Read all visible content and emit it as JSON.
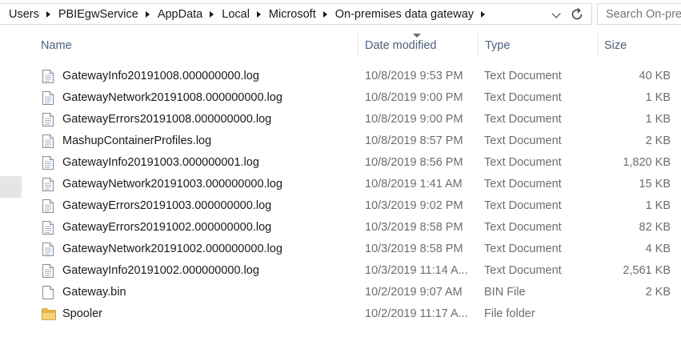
{
  "breadcrumb": [
    "Users",
    "PBIEgwService",
    "AppData",
    "Local",
    "Microsoft",
    "On-premises data gateway"
  ],
  "search": {
    "placeholder": "Search On-premises data gateway"
  },
  "columns": {
    "name": "Name",
    "date": "Date modified",
    "type": "Type",
    "size": "Size"
  },
  "sort": {
    "column": "date",
    "direction": "descending"
  },
  "files": [
    {
      "name": "GatewayInfo20191008.000000000.log",
      "date": "10/8/2019 9:53 PM",
      "type": "Text Document",
      "size": "40 KB",
      "icon": "text-file-icon"
    },
    {
      "name": "GatewayNetwork20191008.000000000.log",
      "date": "10/8/2019 9:00 PM",
      "type": "Text Document",
      "size": "1 KB",
      "icon": "text-file-icon"
    },
    {
      "name": "GatewayErrors20191008.000000000.log",
      "date": "10/8/2019 9:00 PM",
      "type": "Text Document",
      "size": "1 KB",
      "icon": "text-file-icon"
    },
    {
      "name": "MashupContainerProfiles.log",
      "date": "10/8/2019 8:57 PM",
      "type": "Text Document",
      "size": "2 KB",
      "icon": "text-file-icon"
    },
    {
      "name": "GatewayInfo20191003.000000001.log",
      "date": "10/8/2019 8:56 PM",
      "type": "Text Document",
      "size": "1,820 KB",
      "icon": "text-file-icon"
    },
    {
      "name": "GatewayNetwork20191003.000000000.log",
      "date": "10/8/2019 1:41 AM",
      "type": "Text Document",
      "size": "15 KB",
      "icon": "text-file-icon"
    },
    {
      "name": "GatewayErrors20191003.000000000.log",
      "date": "10/3/2019 9:02 PM",
      "type": "Text Document",
      "size": "1 KB",
      "icon": "text-file-icon"
    },
    {
      "name": "GatewayErrors20191002.000000000.log",
      "date": "10/3/2019 8:58 PM",
      "type": "Text Document",
      "size": "82 KB",
      "icon": "text-file-icon"
    },
    {
      "name": "GatewayNetwork20191002.000000000.log",
      "date": "10/3/2019 8:58 PM",
      "type": "Text Document",
      "size": "4 KB",
      "icon": "text-file-icon"
    },
    {
      "name": "GatewayInfo20191002.000000000.log",
      "date": "10/3/2019 11:14 A...",
      "type": "Text Document",
      "size": "2,561 KB",
      "icon": "text-file-icon"
    },
    {
      "name": "Gateway.bin",
      "date": "10/2/2019 9:07 AM",
      "type": "BIN File",
      "size": "2 KB",
      "icon": "blank-file-icon"
    },
    {
      "name": "Spooler",
      "date": "10/2/2019 11:17 A...",
      "type": "File folder",
      "size": "",
      "icon": "folder-icon"
    }
  ],
  "colors": {
    "header_text": "#4c607a",
    "secondary_text": "#6d6d6d",
    "folder": "#e8b84a",
    "nav_selected": "#e5e5e5"
  }
}
